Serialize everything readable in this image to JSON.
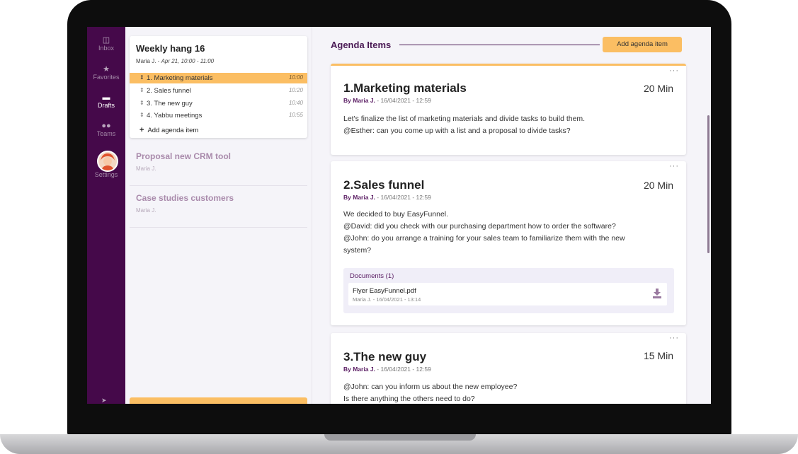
{
  "rail": {
    "items": [
      {
        "label": "Inbox",
        "icon": "inbox-icon"
      },
      {
        "label": "Favorites",
        "icon": "star-icon"
      },
      {
        "label": "Drafts",
        "icon": "folder-icon"
      },
      {
        "label": "Teams",
        "icon": "teams-icon"
      }
    ],
    "settings_label": "Settings",
    "active": "Drafts"
  },
  "meeting": {
    "title": "Weekly hang 16",
    "organizer": "Maria J.",
    "when": "Apr 21, 10:00 - 11:00",
    "separator": " - ",
    "agenda": [
      {
        "label": "1. Marketing materials",
        "time": "10:00",
        "selected": true
      },
      {
        "label": "2. Sales funnel",
        "time": "10:20"
      },
      {
        "label": "3. The new guy",
        "time": "10:40"
      },
      {
        "label": "4. Yabbu meetings",
        "time": "10:55"
      }
    ],
    "add_label": "Add agenda item"
  },
  "other_meetings": [
    {
      "title": "Proposal new CRM tool",
      "organizer": "Maria J."
    },
    {
      "title": "Case studies customers",
      "organizer": "Maria J."
    }
  ],
  "main": {
    "header": "Agenda Items",
    "add_button": "Add agenda item",
    "by_prefix": "By",
    "items": [
      {
        "title": "1.Marketing materials",
        "duration": "20 Min",
        "author": "Maria J.",
        "date": " -  16/04/2021 - 12:59",
        "body": [
          "Let's finalize the list of marketing materials and divide tasks to build them.",
          "@Esther: can you come up with a list and a proposal to divide tasks?"
        ]
      },
      {
        "title": "2.Sales funnel",
        "duration": "20 Min",
        "author": "Maria J.",
        "date": " -  16/04/2021 - 12:59",
        "body": [
          "We decided to buy EasyFunnel.",
          "@David: did you check with our purchasing department how to order the software?",
          "@John: do you arrange a training for your sales team to familiarize them with the new",
          "system?"
        ],
        "documents": {
          "title": "Documents (1)",
          "files": [
            {
              "name": "Flyer EasyFunnel.pdf",
              "meta": "Maria J. - 16/04/2021 - 13:14"
            }
          ]
        }
      },
      {
        "title": "3.The new guy",
        "duration": "15 Min",
        "author": "Maria J.",
        "date": " -  16/04/2021 - 12:59",
        "body": [
          "@John: can you inform us about the new employee?",
          "Is there anything the others need to do?"
        ]
      }
    ]
  },
  "colors": {
    "rail": "#45094a",
    "accent": "#fbbe63",
    "brand_text": "#4a1a55"
  }
}
